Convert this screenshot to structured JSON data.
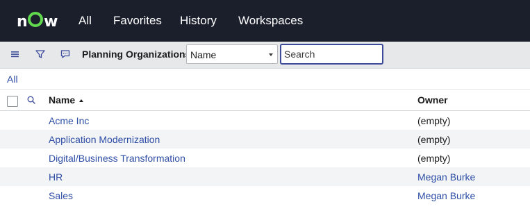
{
  "topnav": {
    "logo_text": "now",
    "items": [
      "All",
      "Favorites",
      "History",
      "Workspaces"
    ]
  },
  "toolbar": {
    "list_title": "Planning Organizations",
    "search_field": {
      "selected": "Name"
    },
    "search": {
      "value": "",
      "placeholder": "Search"
    }
  },
  "breadcrumb": {
    "label": "All"
  },
  "table": {
    "columns": [
      {
        "label": "Name",
        "sort": "ascending"
      },
      {
        "label": "Owner"
      }
    ],
    "rows": [
      {
        "name": "Acme Inc",
        "owner": "(empty)",
        "owner_is_link": false
      },
      {
        "name": "Application Modernization",
        "owner": "(empty)",
        "owner_is_link": false
      },
      {
        "name": "Digital/Business Transformation",
        "owner": "(empty)",
        "owner_is_link": false
      },
      {
        "name": "HR",
        "owner": "Megan Burke",
        "owner_is_link": true
      },
      {
        "name": "Sales",
        "owner": "Megan Burke",
        "owner_is_link": true
      }
    ]
  },
  "colors": {
    "nav_background": "#1b1f2c",
    "logo_accent": "#62d84e",
    "link": "#2e4ea6",
    "toolbar_background": "#e6e8ea",
    "search_focus_border": "#3c4b9a",
    "alt_row": "#f3f4f5"
  },
  "icons": {
    "toolbar": [
      "hamburger-menu-icon",
      "filter-icon",
      "comment-icon"
    ],
    "table": [
      "select-all-checkbox",
      "column-search-icon"
    ]
  }
}
